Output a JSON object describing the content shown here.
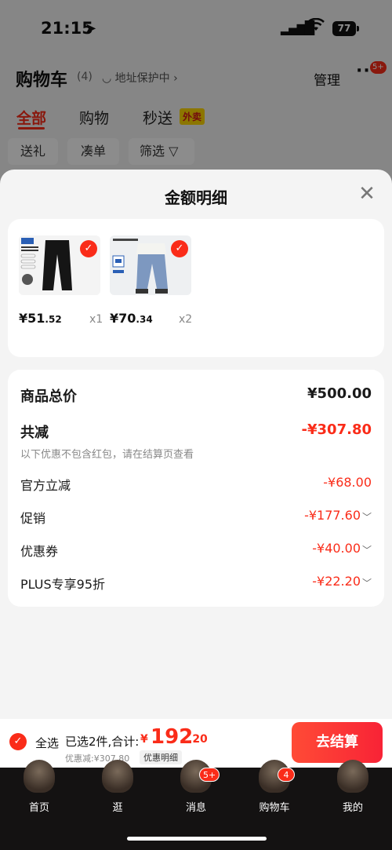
{
  "status_bar": {
    "time": "21:15",
    "battery": "77"
  },
  "header": {
    "title": "购物车",
    "count": "(4)",
    "address": "地址保护中",
    "manage": "管理",
    "more_badge": "5+"
  },
  "tabs": [
    {
      "label": "全部"
    },
    {
      "label": "购物"
    },
    {
      "label": "秒送"
    }
  ],
  "takeout_tag": "外卖",
  "filters": [
    {
      "label": "送礼"
    },
    {
      "label": "凑单"
    },
    {
      "label": "筛选"
    }
  ],
  "sheet": {
    "title": "金额明细",
    "products": [
      {
        "price_int": "¥51",
        "price_dec": ".52",
        "qty": "x1"
      },
      {
        "price_int": "¥70",
        "price_dec": ".34",
        "qty": "x2"
      }
    ],
    "summary": {
      "total_label": "商品总价",
      "total_value": "¥500.00",
      "discount_label": "共减",
      "discount_value": "-¥307.80",
      "note": "以下优惠不包含红包，请在结算页查看",
      "items": [
        {
          "label": "官方立减",
          "value": "-¥68.00",
          "expandable": false
        },
        {
          "label": "促销",
          "value": "-¥177.60",
          "expandable": true
        },
        {
          "label": "优惠券",
          "value": "-¥40.00",
          "expandable": true
        },
        {
          "label": "PLUS专享95折",
          "value": "-¥22.20",
          "expandable": true
        }
      ]
    }
  },
  "bottom_bar": {
    "select_all": "全选",
    "selected": "已选2件,合计:",
    "currency": "¥",
    "amount": "192",
    "amount_dec": ".20",
    "discount_text": "优惠减:¥307.80",
    "detail_button": "优惠明细",
    "checkout": "去结算"
  },
  "tabbar": [
    {
      "label": "首页",
      "badge": ""
    },
    {
      "label": "逛",
      "badge": ""
    },
    {
      "label": "消息",
      "badge": "5+"
    },
    {
      "label": "购物车",
      "badge": "4"
    },
    {
      "label": "我的",
      "badge": ""
    }
  ],
  "colors": {
    "accent": "#fa2c19",
    "tabbar_bg": "#141212"
  }
}
